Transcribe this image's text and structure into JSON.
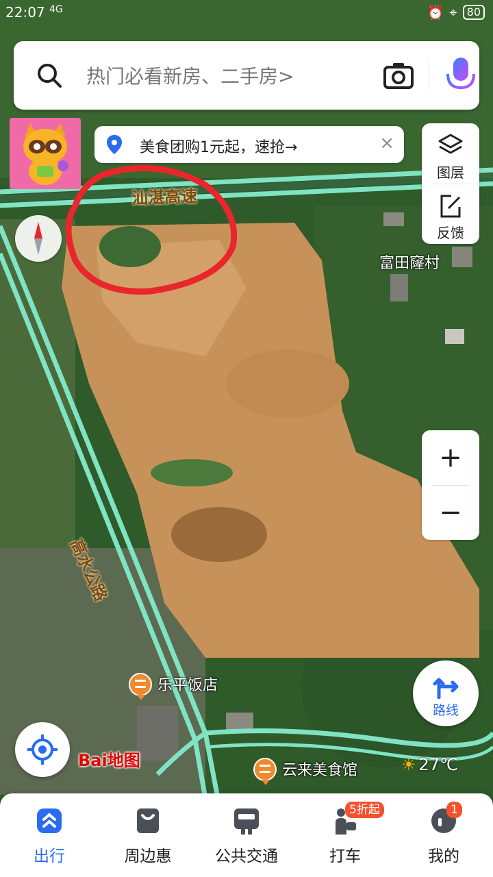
{
  "status_bar": {
    "time": "22:07",
    "network": "4G",
    "battery": "80"
  },
  "search": {
    "placeholder": "热门必看新房、二手房>"
  },
  "promo": {
    "text": "美食团购1元起，速抢→",
    "close": "×"
  },
  "tools": {
    "layers_label": "图层",
    "feedback_label": "反馈"
  },
  "zoom": {
    "in": "+",
    "out": "−"
  },
  "map_labels": {
    "highway": "汕湛高速",
    "village": "富田窿村",
    "road": "高水公路",
    "restaurant_1": "乐平饭店",
    "restaurant_2": "云来美食馆"
  },
  "route": {
    "label": "路线"
  },
  "logo": {
    "text": "Bai地图"
  },
  "weather": {
    "temp": "27℃",
    "icon": "sun-icon"
  },
  "bottom_nav": [
    {
      "label": "出行",
      "icon": "travel-icon",
      "active": true
    },
    {
      "label": "周边惠",
      "icon": "bag-icon"
    },
    {
      "label": "公共交通",
      "icon": "bus-icon"
    },
    {
      "label": "打车",
      "icon": "taxi-icon",
      "badge": "5折起"
    },
    {
      "label": "我的",
      "icon": "profile-icon",
      "badge": "1"
    }
  ],
  "colors": {
    "accent": "#2a6cf0",
    "road": "#7fe3c4",
    "annotation": "#e8262b",
    "dirt": "#c79259"
  }
}
